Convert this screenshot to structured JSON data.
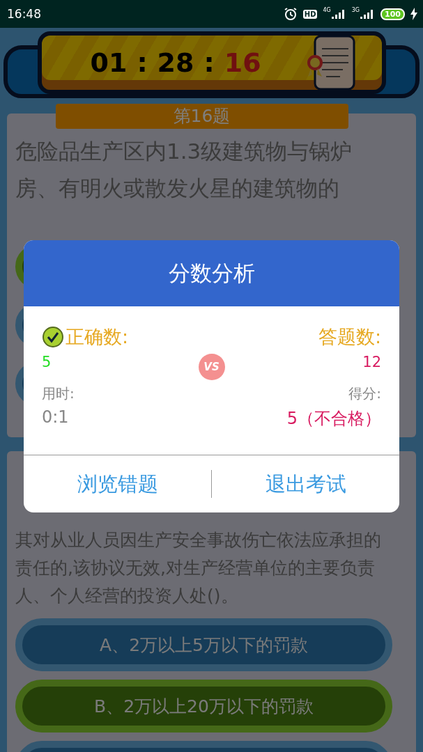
{
  "status_bar": {
    "time": "16:48",
    "hd": "HD",
    "network_1": "4G",
    "network_2": "3G",
    "battery": "100",
    "charging": true
  },
  "timer": {
    "hours": "01",
    "sep_1": ":",
    "minutes": "28",
    "sep_2": ":",
    "seconds": "16"
  },
  "question": {
    "number": "第16题",
    "text": "危险品生产区内1.3级建筑物与锅炉房、有明火或散发火星的建筑物的",
    "options": [
      {
        "correct": true
      },
      {
        "correct": false
      },
      {
        "correct": false
      }
    ]
  },
  "next_question": {
    "text": "其对从业人员因生产安全事故伤亡依法应承担的责任的,该协议无效,对生产经营单位的主要负责人、个人经营的投资人处()。",
    "options": [
      {
        "label": "A、2万以上5万以下的罚款",
        "correct": false
      },
      {
        "label": "B、2万以上20万以下的罚款",
        "correct": true
      },
      {
        "correct": false
      }
    ]
  },
  "dialog": {
    "title": "分数分析",
    "correct_label": "正确数:",
    "answered_label": "答题数:",
    "correct_count": "5",
    "vs": "VS",
    "answered_count": "12",
    "time_label": "用时:",
    "score_label": "得分:",
    "time_value": "0:1",
    "score_value": "5（不合格）",
    "buttons": [
      "浏览错题",
      "退出考试"
    ]
  }
}
